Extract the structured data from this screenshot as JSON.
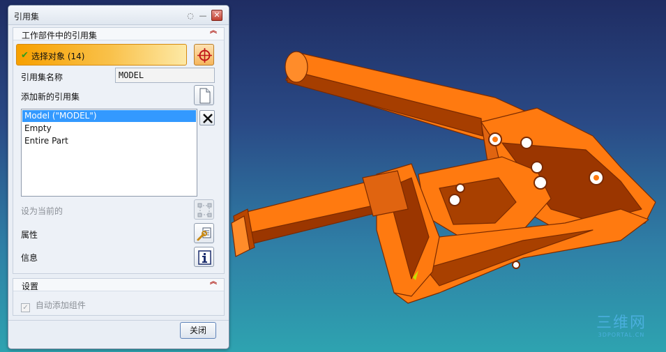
{
  "dialog": {
    "title": "引用集",
    "title_controls": {
      "reset": "◌",
      "minimize": "—",
      "close": "✕"
    },
    "section_main": {
      "title": "工作部件中的引用集",
      "collapse_glyph": "︽"
    },
    "select_objects": {
      "label": "选择对象 (14)",
      "status_glyph": "✔"
    },
    "refset_name": {
      "label": "引用集名称",
      "value": "MODEL"
    },
    "add_new": {
      "label": "添加新的引用集"
    },
    "list": {
      "items": [
        "Model (\"MODEL\")",
        "Empty",
        "Entire Part"
      ],
      "selected_index": 0
    },
    "set_current": {
      "label": "设为当前的"
    },
    "properties": {
      "label": "属性"
    },
    "info": {
      "label": "信息"
    },
    "section_settings": {
      "title": "设置",
      "collapse_glyph": "︽"
    },
    "auto_add": {
      "label": "自动添加组件",
      "checked": true,
      "check_glyph": "✓"
    },
    "close_label": "关闭"
  },
  "icons": {
    "target": "crosshair-icon",
    "new": "new-document-icon",
    "delete": "delete-x-icon",
    "set_current": "set-current-icon",
    "properties": "properties-wrench-icon",
    "info": "info-icon"
  },
  "colors": {
    "accent_orange": "#f7a000",
    "model_orange": "#ff7a10",
    "selection_blue": "#3399ff",
    "close_red": "#c2402f"
  },
  "watermark": {
    "main": "三维网",
    "sub": "3DPORTAL.CN"
  }
}
